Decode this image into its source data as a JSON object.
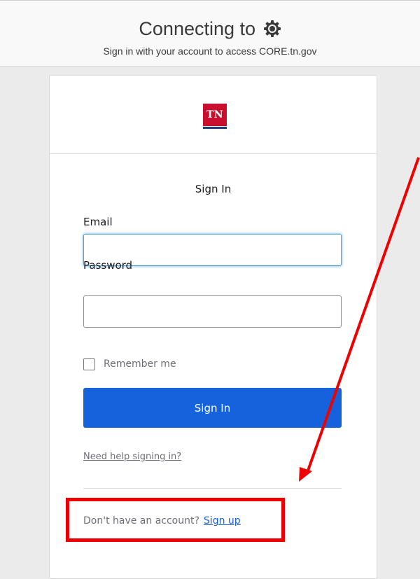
{
  "header": {
    "title": "Connecting to",
    "title_icon": "gear-icon",
    "subtitle": "Sign in with your account to access CORE.tn.gov"
  },
  "logo": {
    "text": "TN",
    "red": "#c8102e",
    "blue": "#1f3b73"
  },
  "form": {
    "heading": "Sign In",
    "email_label": "Email",
    "email_value": "",
    "password_label": "Password",
    "password_value": "",
    "remember_label": "Remember me",
    "remember_checked": false,
    "submit_label": "Sign In",
    "help_link": "Need help signing in?"
  },
  "signup": {
    "prompt": "Don't have an account?",
    "link": "Sign up"
  },
  "annotation": {
    "color": "#ee0000"
  },
  "colors": {
    "accent": "#1662dd",
    "focus": "#4ea0dd"
  }
}
